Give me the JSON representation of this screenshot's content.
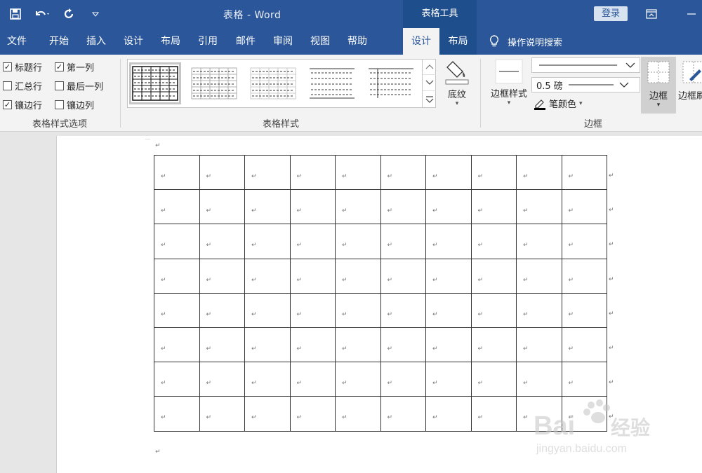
{
  "window": {
    "title": "表格 - Word",
    "context_tool": "表格工具",
    "login": "登录"
  },
  "tabs": [
    {
      "label": "文件"
    },
    {
      "label": "开始"
    },
    {
      "label": "插入"
    },
    {
      "label": "设计"
    },
    {
      "label": "布局"
    },
    {
      "label": "引用"
    },
    {
      "label": "邮件"
    },
    {
      "label": "审阅"
    },
    {
      "label": "视图"
    },
    {
      "label": "帮助"
    }
  ],
  "context_tabs": [
    {
      "label": "设计",
      "active": true
    },
    {
      "label": "布局",
      "active": false
    }
  ],
  "tell_me": "操作说明搜索",
  "style_options": {
    "group_label": "表格样式选项",
    "items": [
      {
        "label": "标题行",
        "checked": true
      },
      {
        "label": "第一列",
        "checked": true
      },
      {
        "label": "汇总行",
        "checked": false
      },
      {
        "label": "最后一列",
        "checked": false
      },
      {
        "label": "镶边行",
        "checked": true
      },
      {
        "label": "镶边列",
        "checked": false
      }
    ]
  },
  "table_styles": {
    "group_label": "表格样式",
    "shading": "底纹"
  },
  "borders": {
    "group_label": "边框",
    "border_styles": "边框样式",
    "weight": "0.5 磅",
    "pen_color": "笔颜色",
    "borders_btn": "边框",
    "painter": "边框刷"
  },
  "document": {
    "rows": 8,
    "cols": 10,
    "cell_mark": "↵",
    "para_mark": "↵"
  },
  "watermark": {
    "text": "Bai 经验",
    "url": "jingyan.baidu.com"
  },
  "colors": {
    "brand": "#2b579a",
    "ribbon_bg": "#f3f3f3"
  }
}
